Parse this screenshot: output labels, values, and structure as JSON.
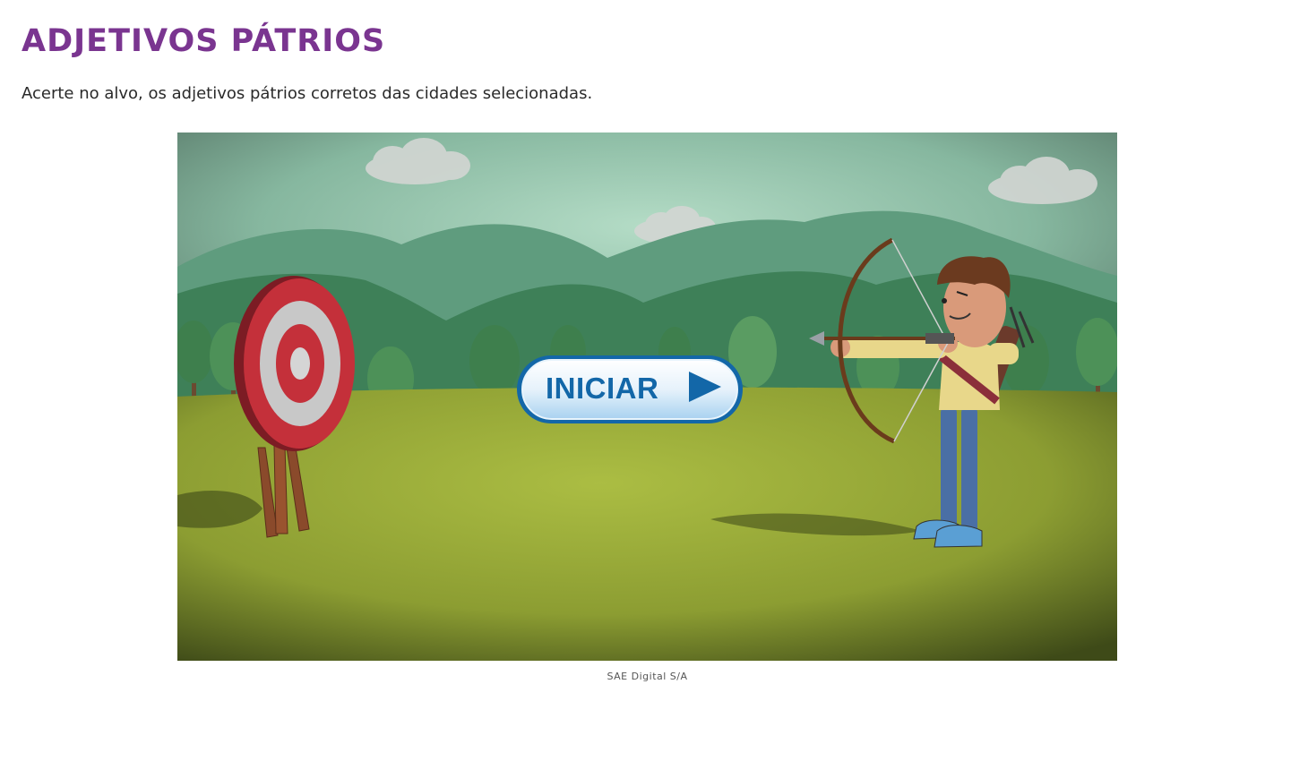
{
  "header": {
    "title": "ADJETIVOS PÁTRIOS",
    "instructions": "Acerte no alvo, os adjetivos pátrios corretos das cidades selecionadas."
  },
  "game": {
    "start_button_label": "INICIAR",
    "scene_icons": [
      "target-icon",
      "archer-icon",
      "cloud-icon",
      "tree-icon",
      "play-arrow-icon"
    ]
  },
  "caption": "SAE Digital S/A",
  "colors": {
    "title": "#7a3590",
    "button_text": "#1367a8",
    "sky": "#a9d7bf",
    "grass": "#a6b83c",
    "target_red": "#c4303a"
  }
}
